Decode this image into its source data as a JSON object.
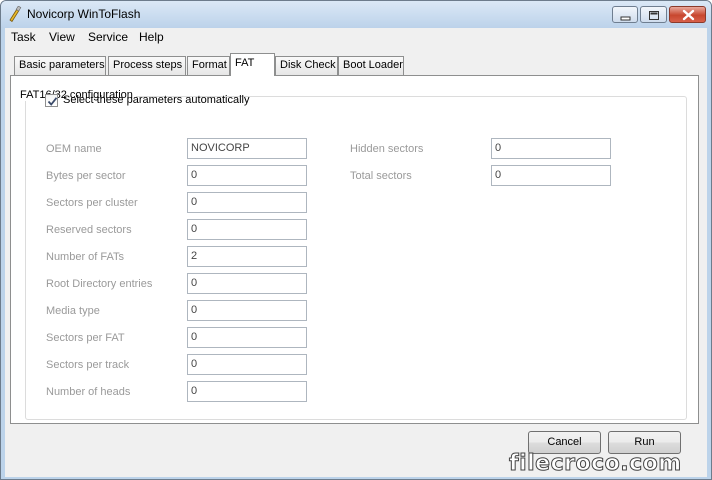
{
  "window": {
    "title": "Novicorp WinToFlash"
  },
  "menu": {
    "items": [
      "Task",
      "View",
      "Service",
      "Help"
    ]
  },
  "tabs": [
    {
      "label": "Basic parameters",
      "active": false
    },
    {
      "label": "Process steps",
      "active": false
    },
    {
      "label": "Format",
      "active": false
    },
    {
      "label": "FAT",
      "active": true
    },
    {
      "label": "Disk Check",
      "active": false
    },
    {
      "label": "Boot Loader",
      "active": false
    }
  ],
  "group": {
    "title": "FAT16/32 configuration",
    "auto_checkbox": {
      "label": "Select these parameters automatically",
      "checked": true
    }
  },
  "fields_left": [
    {
      "label": "OEM name",
      "value": "NOVICORP"
    },
    {
      "label": "Bytes per sector",
      "value": "0"
    },
    {
      "label": "Sectors per cluster",
      "value": "0"
    },
    {
      "label": "Reserved sectors",
      "value": "0"
    },
    {
      "label": "Number of FATs",
      "value": "2"
    },
    {
      "label": "Root Directory entries",
      "value": "0"
    },
    {
      "label": "Media type",
      "value": "0"
    },
    {
      "label": "Sectors per FAT",
      "value": "0"
    },
    {
      "label": "Sectors per track",
      "value": "0"
    },
    {
      "label": "Number of heads",
      "value": "0"
    }
  ],
  "fields_right": [
    {
      "label": "Hidden sectors",
      "value": "0"
    },
    {
      "label": "Total sectors",
      "value": "0"
    }
  ],
  "buttons": {
    "cancel": "Cancel",
    "run": "Run"
  },
  "watermark": {
    "text": "filecroco.com"
  },
  "colors": {
    "titlebar": "#bcd3ea",
    "close_button": "#c8472f",
    "disabled_label": "#9a9a9a"
  }
}
